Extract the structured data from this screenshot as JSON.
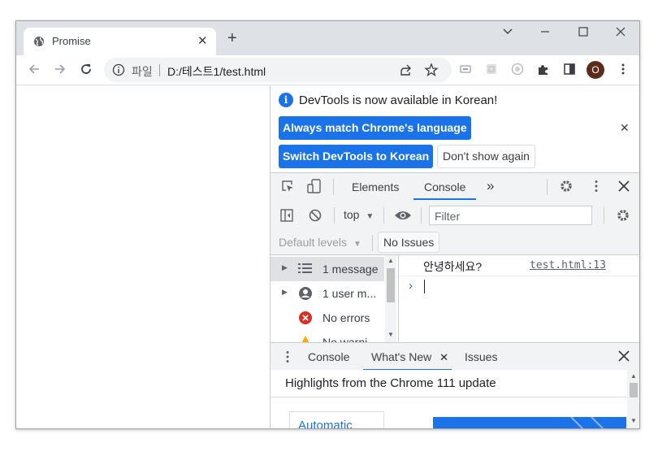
{
  "tab": {
    "title": "Promise",
    "close": "✕",
    "new_tab": "+"
  },
  "window_controls": {
    "dropdown": "⌵",
    "minimize": "—",
    "maximize": "☐",
    "close": "✕"
  },
  "omnibox": {
    "scheme_label": "파일",
    "url": "D:/테스트1/test.html"
  },
  "profile": {
    "initial": "O"
  },
  "infobar": {
    "message": "DevTools is now available in Korean!",
    "match_language_label": "Always match Chrome's language",
    "switch_label": "Switch DevTools to Korean",
    "dont_show_label": "Don't show again",
    "close": "✕"
  },
  "devtools_tabs": {
    "elements": "Elements",
    "console": "Console",
    "more": "»"
  },
  "console_toolbar": {
    "context": "top",
    "filter_placeholder": "Filter",
    "levels": "Default levels",
    "issues": "No Issues"
  },
  "sidebar": {
    "items": [
      {
        "label": "1 message"
      },
      {
        "label": "1 user m..."
      },
      {
        "label": "No errors"
      },
      {
        "label": "No warni..."
      }
    ]
  },
  "console": {
    "log_text": "안녕하세요?",
    "log_source": "test.html:13",
    "prompt": "›"
  },
  "drawer": {
    "tab_console": "Console",
    "tab_whats_new": "What's New",
    "tab_issues": "Issues",
    "close": "✕",
    "highlights": "Highlights from the Chrome 111 update",
    "card_link": "Automatic"
  }
}
